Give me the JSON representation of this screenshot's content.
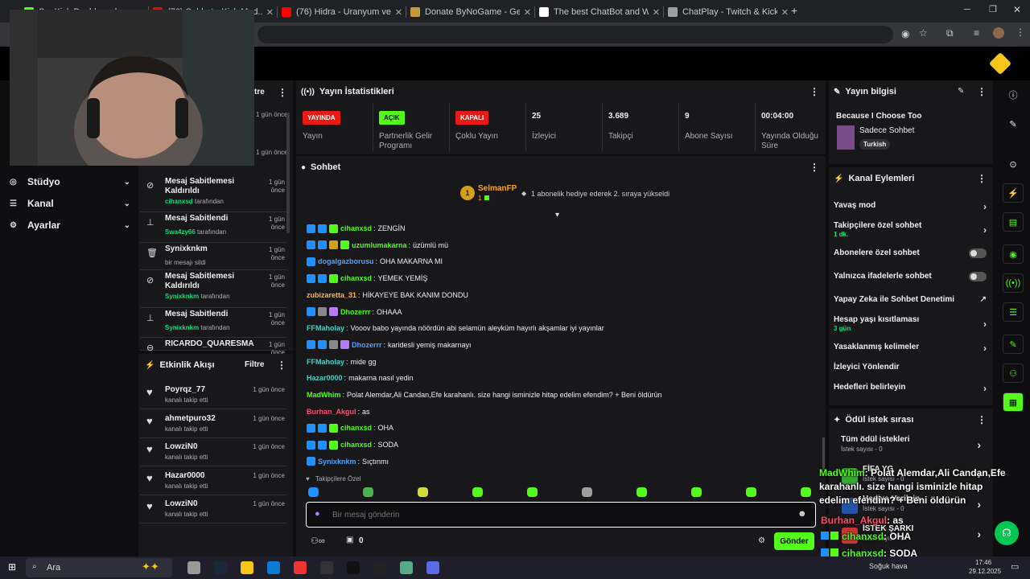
{
  "browser": {
    "tabs": [
      {
        "label": "S... Kick Dashboard",
        "color": "#53fc18"
      },
      {
        "label": "(76) Sohbet - Kick Mod...",
        "color": "#ff0000"
      },
      {
        "label": "(76) Hidra - Uranyum ve Roket",
        "color": "#ff0000"
      },
      {
        "label": "Donate ByNoGame - Gelen/Gi...",
        "color": "#c49a3a"
      },
      {
        "label": "The best ChatBot and Widgets...",
        "color": "#ffffff"
      },
      {
        "label": "ChatPlay - Twitch & Kick İzleyic...",
        "color": "#9aa0a6"
      }
    ],
    "new_tab": "+"
  },
  "sidebar": {
    "menu": [
      {
        "label": "Stüdyo",
        "icon": "studio-icon"
      },
      {
        "label": "Kanal",
        "icon": "channel-icon"
      },
      {
        "label": "Ayarlar",
        "icon": "settings-icon"
      }
    ]
  },
  "mod_actions": {
    "header_partial": "tre",
    "items": [
      {
        "title": "Mesaj Sabitlemesi Kaldırıldı",
        "user": "cihanxsd",
        "suffix": "tarafından",
        "time": "1 gün önce",
        "icon": "unpin-icon"
      },
      {
        "title": "Mesaj Sabitlendi",
        "user": "Swa4zy66",
        "suffix": "tarafından",
        "time": "1 gün önce",
        "icon": "pin-icon"
      },
      {
        "title": "Synixknkm",
        "user": "",
        "suffix": "bir mesajı sildi",
        "time": "1 gün önce",
        "icon": "trash-icon"
      },
      {
        "title": "Mesaj Sabitlemesi Kaldırıldı",
        "user": "Synixknkm",
        "suffix": "tarafından",
        "time": "1 gün önce",
        "icon": "unpin-icon"
      },
      {
        "title": "Mesaj Sabitlendi",
        "user": "Synixknkm",
        "suffix": "tarafından",
        "time": "1 gün önce",
        "icon": "pin-icon"
      },
      {
        "title": "RICARDO_QUARESMA",
        "user": "",
        "suffix": "",
        "time": "1 gün önce",
        "icon": "ban-icon"
      }
    ],
    "partial_times": [
      "1 gün önce",
      "1 gün önce"
    ]
  },
  "activity": {
    "title": "Etkinlik Akışı",
    "filter": "Filtre",
    "items": [
      {
        "user": "Poyrqz_77",
        "text": "kanalı takip etti",
        "time": "1 gün önce"
      },
      {
        "user": "ahmetpuro32",
        "text": "kanalı takip etti",
        "time": "1 gün önce"
      },
      {
        "user": "LowziN0",
        "text": "kanalı takip etti",
        "time": "1 gün önce"
      },
      {
        "user": "Hazar0000",
        "text": "kanalı takip etti",
        "time": "1 gün önce"
      },
      {
        "user": "LowziN0",
        "text": "kanalı takip etti",
        "time": "1 gün önce"
      }
    ]
  },
  "stats": {
    "title": "Yayın İstatistikleri",
    "cells": [
      {
        "badge": "YAYINDA",
        "badge_color": "#e91916",
        "label": "Yayın"
      },
      {
        "badge": "AÇIK",
        "badge_color": "#53fc18",
        "label": "Partnerlik Gelir Programı"
      },
      {
        "badge": "KAPALI",
        "badge_color": "#e91916",
        "label": "Çoklu Yayın"
      },
      {
        "value": "25",
        "label": "İzleyici"
      },
      {
        "value": "3.689",
        "label": "Takipçi"
      },
      {
        "value": "9",
        "label": "Abone Sayısı"
      },
      {
        "value": "00:04:00",
        "label": "Yayında Olduğu Süre"
      }
    ]
  },
  "chat": {
    "title": "Sohbet",
    "pinned_user": "SelmanFP",
    "pinned_count": "1",
    "pinned_gift_count": "1",
    "pinned_text": "1 abonelik hediye ederek 2. sıraya yükseldi",
    "messages": [
      {
        "user": "cihanxsd",
        "color": "#53fc18",
        "text": "ZENGİN",
        "badges": [
          "#1e90ff",
          "#1e90ff",
          "#53fc18"
        ]
      },
      {
        "user": "uzumlumakarna",
        "color": "#53fc18",
        "text": "üzümlü mü",
        "badges": [
          "#1e90ff",
          "#1e90ff",
          "#d4a017",
          "#53fc18"
        ]
      },
      {
        "user": "dogalgazborusu",
        "color": "#4fa3ff",
        "text": "OHA MAKARNA MI",
        "badges": [
          "#1e90ff"
        ]
      },
      {
        "user": "cihanxsd",
        "color": "#53fc18",
        "text": "YEMEK YEMİŞ",
        "badges": [
          "#1e90ff",
          "#1e90ff",
          "#53fc18"
        ]
      },
      {
        "user": "zubizaretta_31",
        "color": "#ffb347",
        "text": "HİKAYEYE BAK KANIM DONDU",
        "badges": []
      },
      {
        "user": "Dhozerrr",
        "color": "#53fc18",
        "text": "OHAAA",
        "badges": [
          "#1e90ff",
          "#888888",
          "#b57bff"
        ]
      },
      {
        "user": "FFMaholay",
        "color": "#4fd1c5",
        "text": "Vooov babo yayında nöördün abi selamün aleyküm hayırlı akşamlar iyi yayınlar",
        "badges": []
      },
      {
        "user": "Dhozerrr",
        "color": "#4fa3ff",
        "text": "karidesli yemiş makarnayı",
        "badges": [
          "#1e90ff",
          "#1e90ff",
          "#888888",
          "#b57bff"
        ]
      },
      {
        "user": "FFMaholay",
        "color": "#4fd1c5",
        "text": "mide gg",
        "badges": []
      },
      {
        "user": "Hazar0000",
        "color": "#4fd1c5",
        "text": "makarna nasıl yedin",
        "badges": []
      },
      {
        "user": "MadWhim",
        "color": "#53fc18",
        "text": "Polat Alemdar,Ali Candan,Efe karahanlı. size hangi isminizle hitap edelim efendim? + Beni öldürün",
        "badges": []
      },
      {
        "user": "Burhan_Akgul",
        "color": "#ff4d6d",
        "text": "as",
        "badges": []
      },
      {
        "user": "cihanxsd",
        "color": "#53fc18",
        "text": "OHA",
        "badges": [
          "#1e90ff",
          "#1e90ff",
          "#53fc18"
        ]
      },
      {
        "user": "cihanxsd",
        "color": "#53fc18",
        "text": "SODA",
        "badges": [
          "#1e90ff",
          "#1e90ff",
          "#53fc18"
        ]
      },
      {
        "user": "Synixknkm",
        "color": "#4fa3ff",
        "text": "Sıçtınmı",
        "badges": [
          "#1e90ff"
        ]
      }
    ],
    "emote_label": "Takipçilere Özel",
    "input_placeholder": "Bir mesaj gönderin",
    "send_label": "Gönder",
    "bottom_count": "0"
  },
  "stream_info": {
    "title": "Yayın bilgisi",
    "stream_title": "Because I Choose Too",
    "category": "Sadece Sohbet",
    "tag": "Turkish"
  },
  "channel_actions": {
    "title": "Kanal Eylemleri",
    "items": [
      {
        "label": "Yavaş mod",
        "sub": "",
        "control": "chevron"
      },
      {
        "label": "Takipçilere özel sohbet",
        "sub": "1 dk.",
        "control": "chevron"
      },
      {
        "label": "Abonelere özel sohbet",
        "sub": "",
        "control": "toggle"
      },
      {
        "label": "Yalnızca ifadelerle sohbet",
        "sub": "",
        "control": "toggle"
      },
      {
        "label": "Yapay Zeka ile Sohbet Denetimi",
        "sub": "",
        "control": "external"
      },
      {
        "label": "Hesap yaşı kısıtlaması",
        "sub": "3 gün",
        "control": "chevron"
      },
      {
        "label": "Yasaklanmış kelimeler",
        "sub": "",
        "control": "chevron"
      },
      {
        "label": "İzleyici Yönlendir",
        "sub": "",
        "control": "none"
      },
      {
        "label": "Hedefleri belirleyin",
        "sub": "",
        "control": "chevron"
      }
    ]
  },
  "rewards": {
    "title": "Ödül istek sırası",
    "items": [
      {
        "label": "Tüm ödül istekleri",
        "sub": "İstek sayısı - 0"
      },
      {
        "label": "FİFA YG",
        "sub": "İstek sayısı - 0"
      },
      {
        "label": "Hediye Verilsin",
        "sub": "İstek sayısı - 0"
      },
      {
        "label": "İSTEK ŞARKI",
        "sub": "İstek sayısı - 0"
      }
    ]
  },
  "overlay": {
    "lines": [
      {
        "user": "MadWhim",
        "color": "#53fc18",
        "text": ": Polat Alemdar,Ali Candan,Efe karahanlı. size hangi isminizle hitap edelim efendim? + Beni öldürün"
      },
      {
        "user": "Burhan_Akgul",
        "color": "#ff4d6d",
        "text": ": as"
      },
      {
        "user": "cihanxsd",
        "color": "#53fc18",
        "text": ": OHA"
      },
      {
        "user": "cihanxsd",
        "color": "#53fc18",
        "text": ": SODA"
      }
    ]
  },
  "taskbar": {
    "search": "Ara",
    "weather": "Soğuk hava",
    "time": "17:46",
    "date": "29.12.2025"
  }
}
